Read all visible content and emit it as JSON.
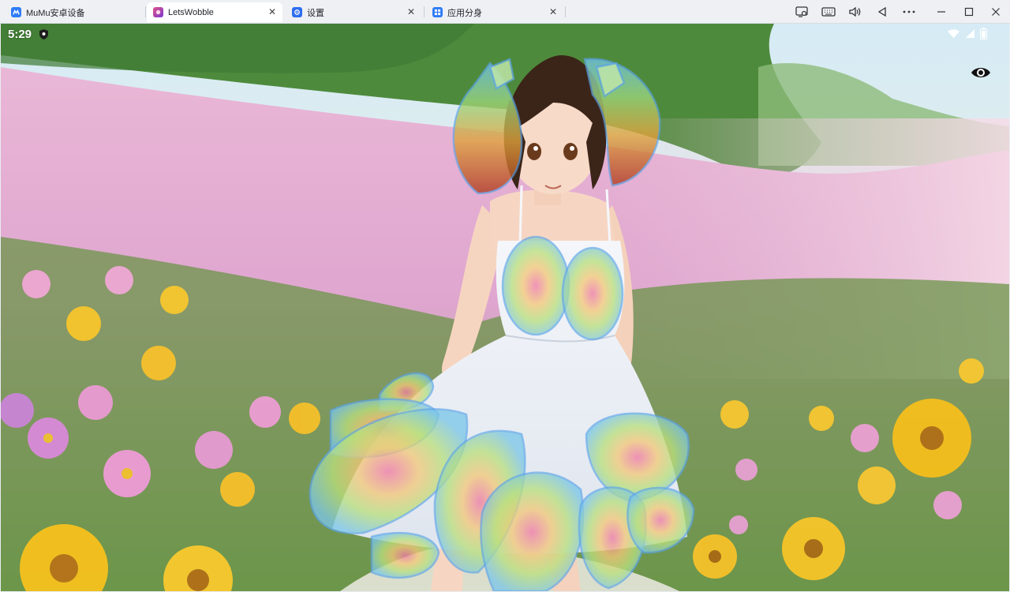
{
  "tabs": [
    {
      "label": "MuMu安卓设备",
      "active": false,
      "icon": "mumu-logo-icon",
      "color": "#2f7cf6"
    },
    {
      "label": "LetsWobble",
      "active": true,
      "icon": "letswobble-app-icon",
      "color": "#c8357a"
    },
    {
      "label": "设置",
      "active": false,
      "icon": "settings-gear-icon",
      "color": "#2f6df0"
    },
    {
      "label": "应用分身",
      "active": false,
      "icon": "app-clone-icon",
      "color": "#2f7cf6"
    }
  ],
  "toolbar": {
    "icons": [
      "screen-record-icon",
      "keyboard-icon",
      "volume-icon",
      "back-icon",
      "more-icon",
      "minimize-icon",
      "maximize-icon",
      "close-icon"
    ]
  },
  "android": {
    "time": "5:29",
    "status_icons": [
      "shield-icon",
      "wifi-icon",
      "cellular-signal-icon",
      "battery-icon"
    ]
  },
  "overlay": {
    "visibility_toggle_icon": "eye-icon",
    "physics_regions": [
      "hair-left",
      "hair-right",
      "chest-left",
      "chest-right",
      "skirt-left-upper",
      "skirt-left-lower",
      "skirt-center",
      "skirt-front",
      "skirt-right-upper",
      "skirt-right-lower",
      "skirt-right-back"
    ]
  },
  "colors": {
    "tab_bar": "#eef0f4",
    "active_tab": "#ffffff",
    "accent": "#2f7cf6"
  }
}
